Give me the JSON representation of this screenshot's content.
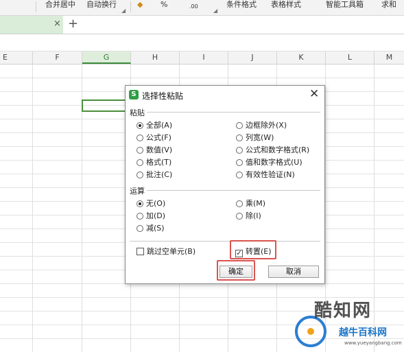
{
  "ribbon": {
    "items": [
      "合并居中",
      "自动换行",
      "%",
      ".00",
      "条件格式",
      "表格样式",
      "智能工具箱",
      "求和"
    ]
  },
  "tabbar": {
    "close_glyph": "×",
    "add_glyph": "+"
  },
  "columns": [
    "E",
    "F",
    "G",
    "H",
    "I",
    "J",
    "K",
    "L",
    "M"
  ],
  "dialog": {
    "title": "选择性粘贴",
    "icon_letter": "S",
    "close_glyph": "✕",
    "paste_group": {
      "label": "粘贴",
      "left_options": [
        {
          "label": "全部(A)",
          "selected": true
        },
        {
          "label": "公式(F)",
          "selected": false
        },
        {
          "label": "数值(V)",
          "selected": false
        },
        {
          "label": "格式(T)",
          "selected": false
        },
        {
          "label": "批注(C)",
          "selected": false
        }
      ],
      "right_options": [
        {
          "label": "边框除外(X)",
          "selected": false
        },
        {
          "label": "列宽(W)",
          "selected": false
        },
        {
          "label": "公式和数字格式(R)",
          "selected": false
        },
        {
          "label": "值和数字格式(U)",
          "selected": false
        },
        {
          "label": "有效性验证(N)",
          "selected": false
        }
      ]
    },
    "operation_group": {
      "label": "运算",
      "left_options": [
        {
          "label": "无(O)",
          "selected": true
        },
        {
          "label": "加(D)",
          "selected": false
        },
        {
          "label": "减(S)",
          "selected": false
        }
      ],
      "right_options": [
        {
          "label": "乘(M)",
          "selected": false
        },
        {
          "label": "除(I)",
          "selected": false
        }
      ]
    },
    "skip_blanks": {
      "label": "跳过空单元(B)",
      "checked": false
    },
    "transpose": {
      "label": "转置(E)",
      "checked": true,
      "check_glyph": "✓"
    },
    "ok_label": "确定",
    "cancel_label": "取消",
    "highlight_color": "#d9534f"
  },
  "watermark": {
    "name": "酷知网",
    "subtitle": "越牛百科网",
    "url": "www.yueyangbang.com"
  }
}
